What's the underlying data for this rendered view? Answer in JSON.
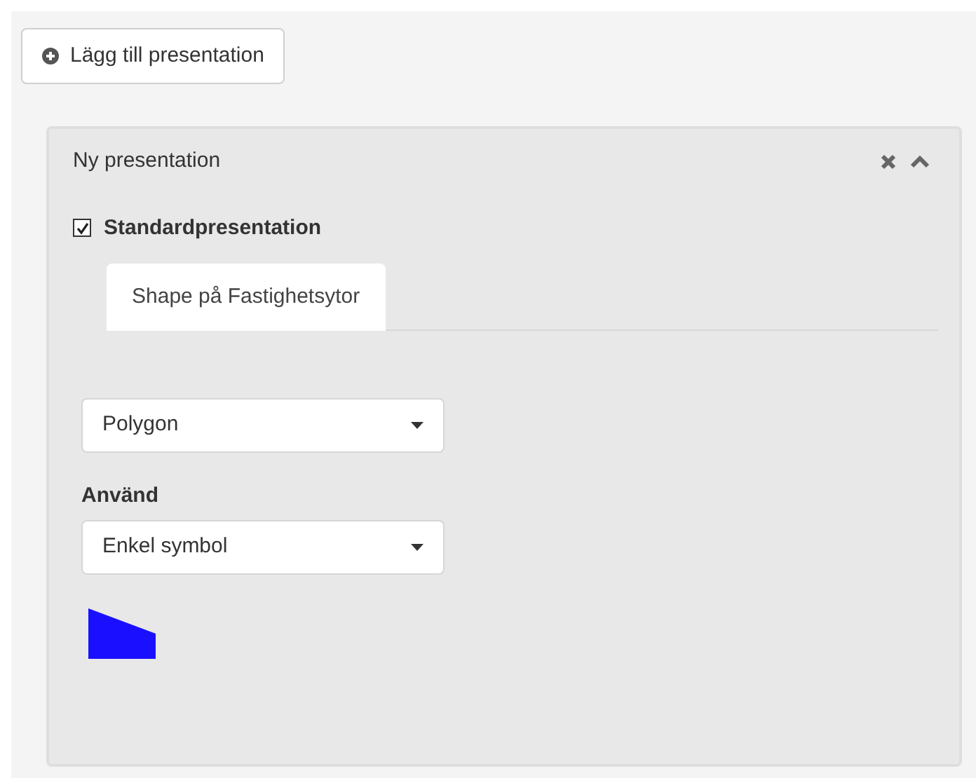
{
  "add_button": {
    "label": "Lägg till presentation"
  },
  "panel": {
    "title": "Ny presentation",
    "expanded": true,
    "default_checkbox": {
      "label": "Standardpresentation",
      "checked": true
    },
    "tabs": [
      {
        "label": "Shape på Fastighetsytor",
        "selected": true
      }
    ],
    "geometry_select": {
      "value": "Polygon"
    },
    "use_label": "Använd",
    "use_select": {
      "value": "Enkel symbol"
    }
  }
}
